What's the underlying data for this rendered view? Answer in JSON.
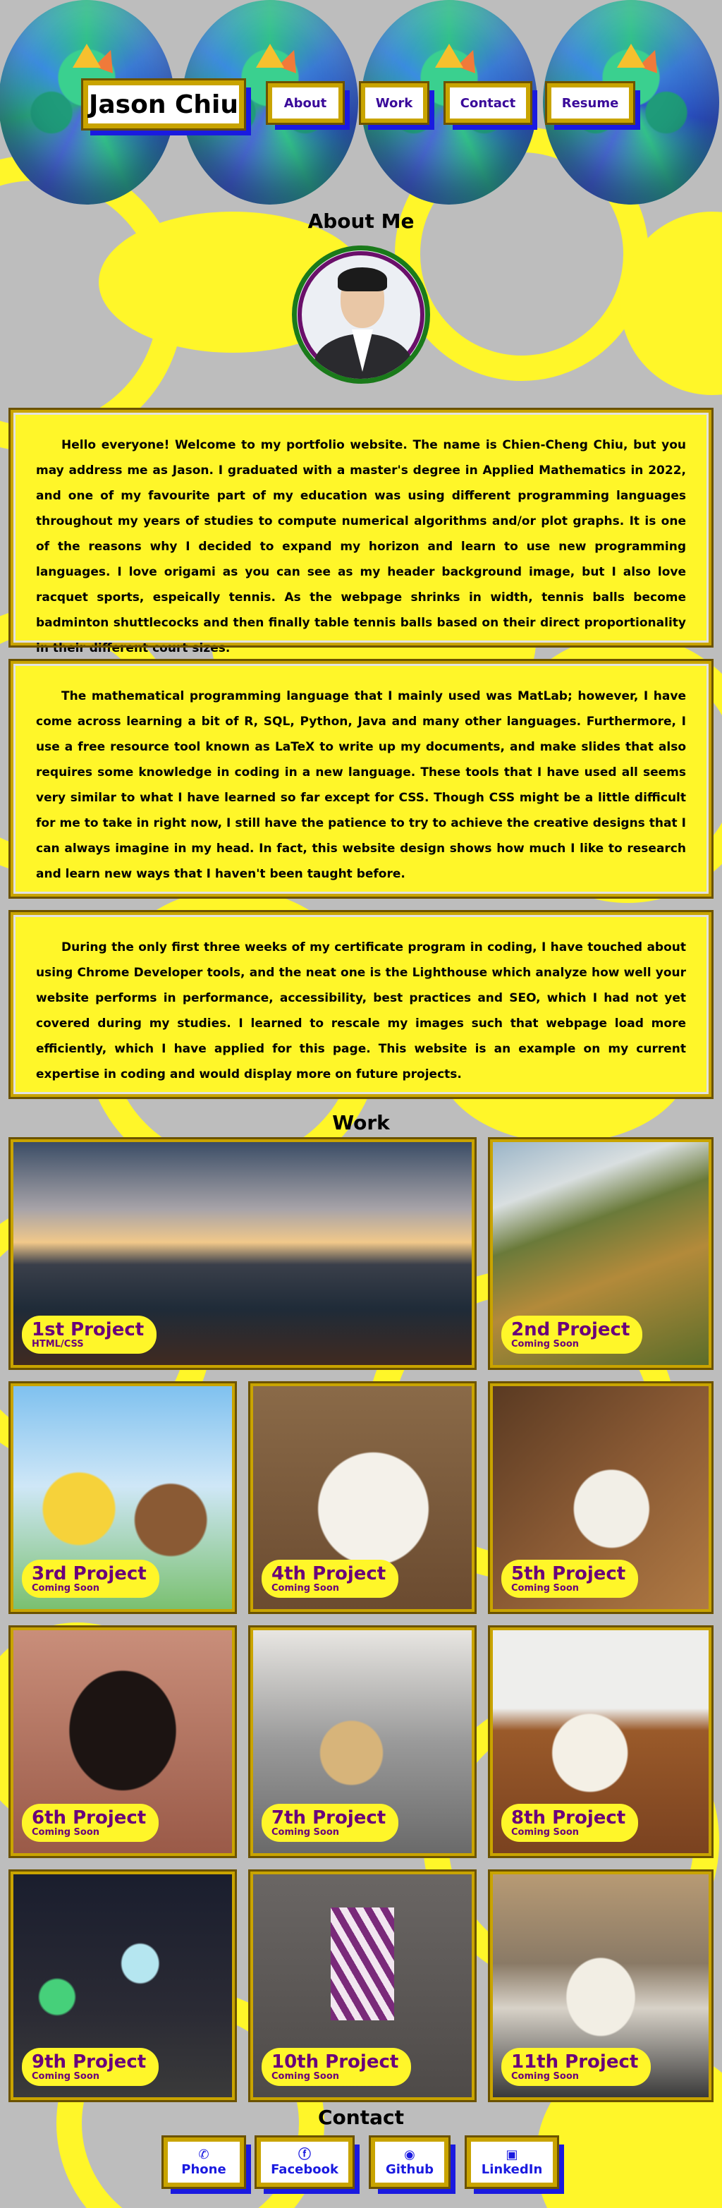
{
  "header": {
    "logo": "Jason Chiu",
    "nav": [
      "About",
      "Work",
      "Contact",
      "Resume"
    ]
  },
  "about": {
    "title": "About Me",
    "paragraphs": [
      "Hello everyone! Welcome to my portfolio website. The name is Chien-Cheng Chiu, but you may address me as Jason. I graduated with a master's degree in Applied Mathematics in 2022, and one of my favourite part of my education was using different programming languages throughout my years of studies to compute numerical algorithms and/or plot graphs. It is one of the reasons why I decided to expand my horizon and learn to use new programming languages. I love origami as you can see as my header background image, but I also love racquet sports, espeically tennis. As the webpage shrinks in width, tennis balls become badminton shuttlecocks and then finally table tennis balls based on their direct proportionality in their different court sizes.",
      "The mathematical programming language that I mainly used was MatLab; however, I have come across learning a bit of R, SQL, Python, Java and many other languages. Furthermore, I use a free resource tool known as LaTeX to write up my documents, and make slides that also requires some knowledge in coding in a new language. These tools that I have used all seems very similar to what I have learned so far except for CSS. Though CSS might be a little difficult for me to take in right now, I still have the patience to try to achieve the creative designs that I can always imagine in my head. In fact, this website design shows how much I like to research and learn new ways that I haven't been taught before.",
      "During the only first three weeks of my certificate program in coding, I have touched about using Chrome Developer tools, and the neat one is the Lighthouse which analyze how well your website performs in performance, accessibility, best practices and SEO, which I had not yet covered during my studies. I learned to rescale my images such that webpage load more efficiently, which I have applied for this page. This website is an example on my current expertise in coding and would display more on future projects."
    ]
  },
  "work": {
    "title": "Work",
    "projects": [
      {
        "name": "1st Project",
        "sub": "HTML/CSS"
      },
      {
        "name": "2nd Project",
        "sub": "Coming Soon"
      },
      {
        "name": "3rd Project",
        "sub": "Coming Soon"
      },
      {
        "name": "4th Project",
        "sub": "Coming Soon"
      },
      {
        "name": "5th Project",
        "sub": "Coming Soon"
      },
      {
        "name": "6th Project",
        "sub": "Coming Soon"
      },
      {
        "name": "7th Project",
        "sub": "Coming Soon"
      },
      {
        "name": "8th Project",
        "sub": "Coming Soon"
      },
      {
        "name": "9th Project",
        "sub": "Coming Soon"
      },
      {
        "name": "10th Project",
        "sub": "Coming Soon"
      },
      {
        "name": "11th Project",
        "sub": "Coming Soon"
      }
    ]
  },
  "contact": {
    "title": "Contact",
    "links": [
      {
        "label": "Phone",
        "icon": "phone-icon",
        "glyph": "✆"
      },
      {
        "label": "Facebook",
        "icon": "facebook-icon",
        "glyph": "ⓕ"
      },
      {
        "label": "Github",
        "icon": "github-icon",
        "glyph": "◉"
      },
      {
        "label": "LinkedIn",
        "icon": "linkedin-icon",
        "glyph": "▣"
      }
    ]
  },
  "colors": {
    "yellow": "#fff629",
    "gold_border": "#c9a400",
    "blue_shadow": "#1a1ae0",
    "purple_text": "#6a007a",
    "background": "#bdbdbd"
  }
}
